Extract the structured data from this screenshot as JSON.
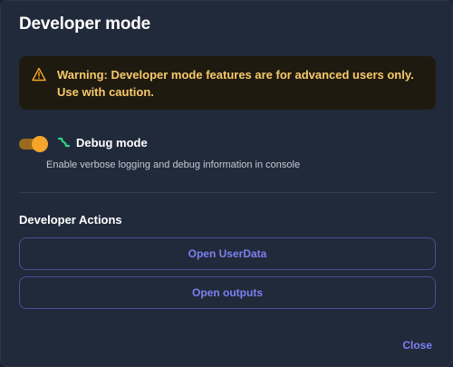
{
  "dialog": {
    "title": "Developer mode",
    "warning": {
      "icon": "warning-triangle-icon",
      "text": "Warning: Developer mode features are for advanced users only. Use with caution.",
      "color": "#f7c96a"
    },
    "debug": {
      "toggle_on": true,
      "icon": "bug-icon",
      "label": "Debug mode",
      "description": "Enable verbose logging and debug information in console"
    },
    "actions": {
      "title": "Developer Actions",
      "buttons": [
        {
          "label": "Open UserData"
        },
        {
          "label": "Open outputs"
        }
      ]
    },
    "close_label": "Close"
  },
  "colors": {
    "accent": "#7b80f0",
    "toggle": "#f5a52a",
    "bug_icon": "#2fd18a",
    "background": "#212a3a"
  }
}
